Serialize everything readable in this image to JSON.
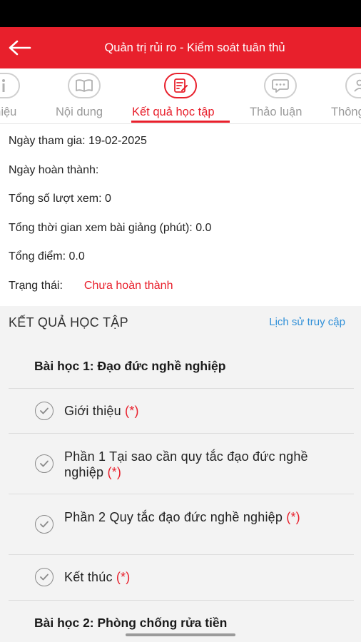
{
  "appbar": {
    "title": "Quản trị rủi ro - Kiểm soát tuân thủ"
  },
  "tabs": [
    {
      "label": "Giới thiệu",
      "icon": "info-icon",
      "active": false
    },
    {
      "label": "Nội dung",
      "icon": "book-icon",
      "active": false
    },
    {
      "label": "Kết quả học tập",
      "icon": "report-icon",
      "active": true
    },
    {
      "label": "Thảo luận",
      "icon": "chat-icon",
      "active": false
    },
    {
      "label": "Thông",
      "icon": "people-icon",
      "active": false
    }
  ],
  "info": {
    "join_date": "Ngày tham gia: 19-02-2025",
    "completion_date": "Ngày hoàn thành:",
    "total_views": "Tổng số lượt xem: 0",
    "total_watch_time": "Tổng thời gian xem bài giảng (phút): 0.0",
    "total_score": "Tổng điểm: 0.0",
    "status_label": "Trạng thái:",
    "status_value": "Chưa hoàn thành"
  },
  "results": {
    "title": "KẾT QUẢ HỌC TẬP",
    "history_link": "Lịch sử truy cập",
    "required_mark": "(*)",
    "lessons": [
      {
        "title": "Bài học 1: Đạo đức nghề nghiệp",
        "items": [
          "Giới thiệu",
          "Phần 1 Tại sao cần quy tắc đạo đức nghề nghiệp",
          "Phần 2 Quy tắc đạo đức nghề nghiệp",
          "Kết thúc"
        ]
      },
      {
        "title": "Bài học 2: Phòng chống rửa tiền",
        "items": []
      }
    ]
  },
  "colors": {
    "primary": "#e8202c",
    "link": "#2f8fd8"
  }
}
